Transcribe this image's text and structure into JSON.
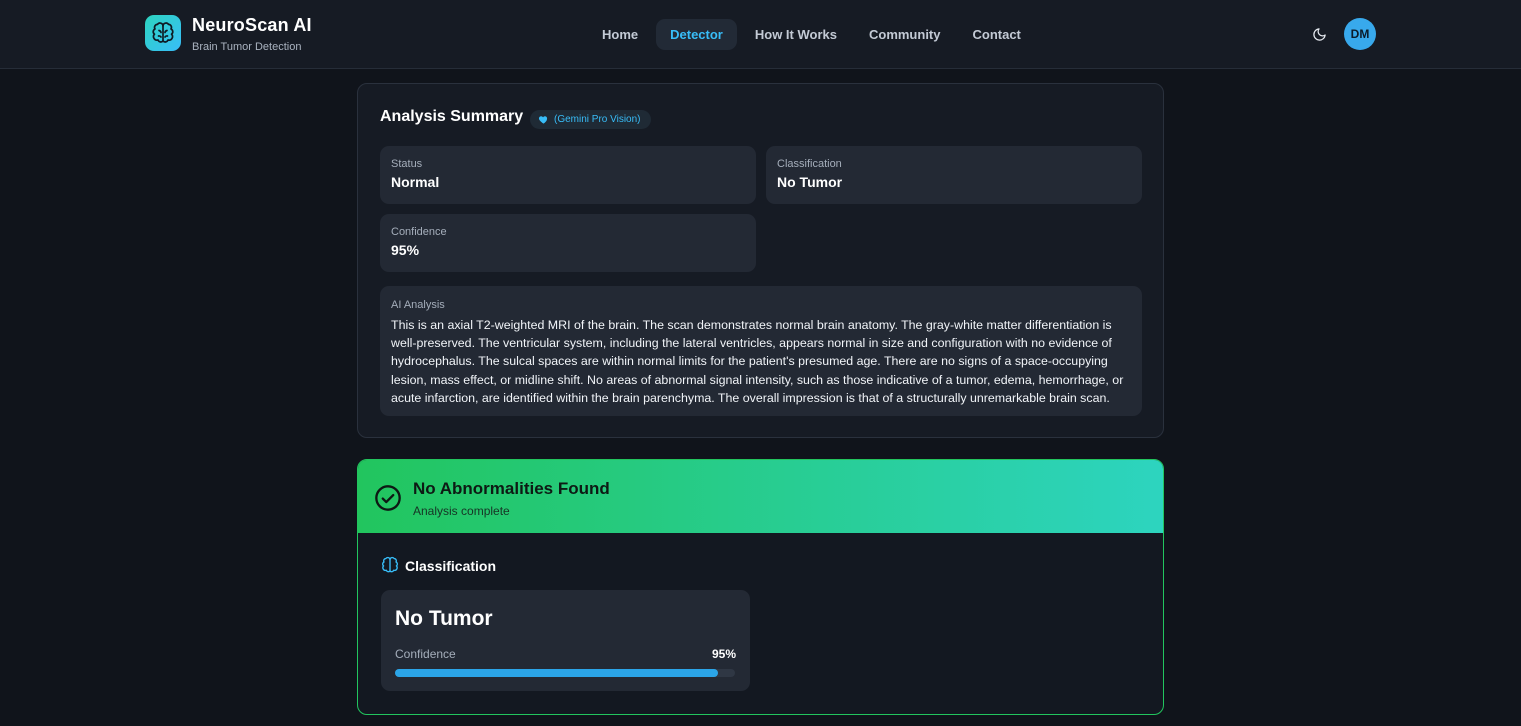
{
  "app": {
    "title": "NeuroScan AI",
    "subtitle": "Brain Tumor Detection",
    "logo_icon": "brain-icon"
  },
  "nav": {
    "items": [
      "Home",
      "Detector",
      "How It Works",
      "Community",
      "Contact"
    ],
    "active": "Detector"
  },
  "header_actions": {
    "theme_icon": "moon-icon",
    "avatar_initials": "DM"
  },
  "summary": {
    "title": "Analysis Summary",
    "badge_icon": "heart-icon",
    "badge_label": "(Gemini Pro Vision)",
    "status_label": "Status",
    "status_value": "Normal",
    "classification_label": "Classification",
    "classification_value": "No Tumor",
    "confidence_label": "Confidence",
    "confidence_value": "95%",
    "analysis_label": "AI Analysis",
    "analysis_text": "This is an axial T2-weighted MRI of the brain. The scan demonstrates normal brain anatomy. The gray-white matter differentiation is well-preserved. The ventricular system, including the lateral ventricles, appears normal in size and configuration with no evidence of hydrocephalus. The sulcal spaces are within normal limits for the patient's presumed age. There are no signs of a space-occupying lesion, mass effect, or midline shift. No areas of abnormal signal intensity, such as those indicative of a tumor, edema, hemorrhage, or acute infarction, are identified within the brain parenchyma. The overall impression is that of a structurally unremarkable brain scan."
  },
  "result": {
    "banner_title": "No Abnormalities Found",
    "banner_subtitle": "Analysis complete",
    "banner_icon": "check-circle-icon",
    "classification_heading": "Classification",
    "classification_icon": "brain-icon",
    "classification_result": "No Tumor",
    "confidence_label": "Confidence",
    "confidence_value": "95%",
    "confidence_fraction": 0.95
  },
  "colors": {
    "accent": "#38bdf8",
    "success": "#22c55e",
    "teal": "#2dd4bf",
    "background": "#10141b",
    "card": "#161b24"
  }
}
